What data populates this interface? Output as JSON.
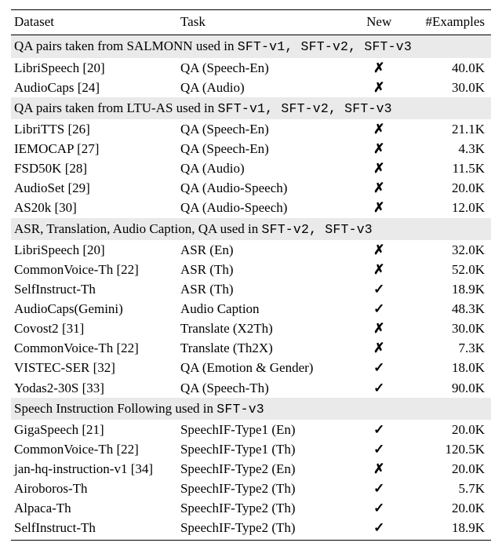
{
  "columns": {
    "dataset": "Dataset",
    "task": "Task",
    "new": "New",
    "examples": "#Examples"
  },
  "icons": {
    "check": "✓",
    "cross": "✗"
  },
  "sections": [
    {
      "header_pre": "QA pairs taken from SALMONN used in ",
      "header_codes": "SFT-v1, SFT-v2, SFT-v3",
      "rows": [
        {
          "ds": "LibriSpeech ",
          "cite": "[20]",
          "task": "QA (Speech-En)",
          "new": false,
          "ex": "40.0K"
        },
        {
          "ds": "AudioCaps ",
          "cite": "[24]",
          "task": "QA (Audio)",
          "new": false,
          "ex": "30.0K"
        }
      ]
    },
    {
      "header_pre": "QA pairs taken from LTU-AS used in ",
      "header_codes": "SFT-v1, SFT-v2, SFT-v3",
      "rows": [
        {
          "ds": "LibriTTS ",
          "cite": "[26]",
          "task": "QA (Speech-En)",
          "new": false,
          "ex": "21.1K"
        },
        {
          "ds": "IEMOCAP ",
          "cite": "[27]",
          "task": "QA (Speech-En)",
          "new": false,
          "ex": "4.3K"
        },
        {
          "ds": "FSD50K ",
          "cite": "[28]",
          "task": "QA (Audio)",
          "new": false,
          "ex": "11.5K"
        },
        {
          "ds": "AudioSet ",
          "cite": "[29]",
          "task": "QA (Audio-Speech)",
          "new": false,
          "ex": "20.0K"
        },
        {
          "ds": "AS20k ",
          "cite": "[30]",
          "task": "QA (Audio-Speech)",
          "new": false,
          "ex": "12.0K"
        }
      ]
    },
    {
      "header_pre": "ASR, Translation, Audio Caption, QA used in ",
      "header_codes": "SFT-v2, SFT-v3",
      "rows": [
        {
          "ds": "LibriSpeech ",
          "cite": "[20]",
          "task": "ASR (En)",
          "new": false,
          "ex": "32.0K"
        },
        {
          "ds": "CommonVoice-Th ",
          "cite": "[22]",
          "task": "ASR (Th)",
          "new": false,
          "ex": "52.0K"
        },
        {
          "ds": "SelfInstruct-Th",
          "cite": "",
          "task": "ASR (Th)",
          "new": true,
          "ex": "18.9K"
        },
        {
          "ds": "AudioCaps(Gemini)",
          "cite": "",
          "task": "Audio Caption",
          "new": true,
          "ex": "48.3K"
        },
        {
          "ds": "Covost2 ",
          "cite": "[31]",
          "task": "Translate (X2Th)",
          "new": false,
          "ex": "30.0K"
        },
        {
          "ds": "CommonVoice-Th ",
          "cite": "[22]",
          "task": "Translate (Th2X)",
          "new": false,
          "ex": "7.3K"
        },
        {
          "ds": "VISTEC-SER ",
          "cite": "[32]",
          "task": "QA (Emotion & Gender)",
          "new": true,
          "ex": "18.0K"
        },
        {
          "ds": "Yodas2-30S ",
          "cite": "[33]",
          "task": "QA (Speech-Th)",
          "new": true,
          "ex": "90.0K"
        }
      ]
    },
    {
      "header_pre": "Speech Instruction Following used in ",
      "header_codes": "SFT-v3",
      "rows": [
        {
          "ds": "GigaSpeech ",
          "cite": "[21]",
          "task": "SpeechIF-Type1 (En)",
          "new": true,
          "ex": "20.0K"
        },
        {
          "ds": "CommonVoice-Th ",
          "cite": "[22]",
          "task": "SpeechIF-Type1 (Th)",
          "new": true,
          "ex": "120.5K"
        },
        {
          "ds": "jan-hq-instruction-v1 ",
          "cite": "[34]",
          "task": "SpeechIF-Type2 (En)",
          "new": false,
          "ex": "20.0K"
        },
        {
          "ds": "Airoboros-Th",
          "cite": "",
          "task": "SpeechIF-Type2 (Th)",
          "new": true,
          "ex": "5.7K"
        },
        {
          "ds": "Alpaca-Th",
          "cite": "",
          "task": "SpeechIF-Type2 (Th)",
          "new": true,
          "ex": "20.0K"
        },
        {
          "ds": "SelfInstruct-Th",
          "cite": "",
          "task": "SpeechIF-Type2 (Th)",
          "new": true,
          "ex": "18.9K"
        }
      ]
    }
  ]
}
